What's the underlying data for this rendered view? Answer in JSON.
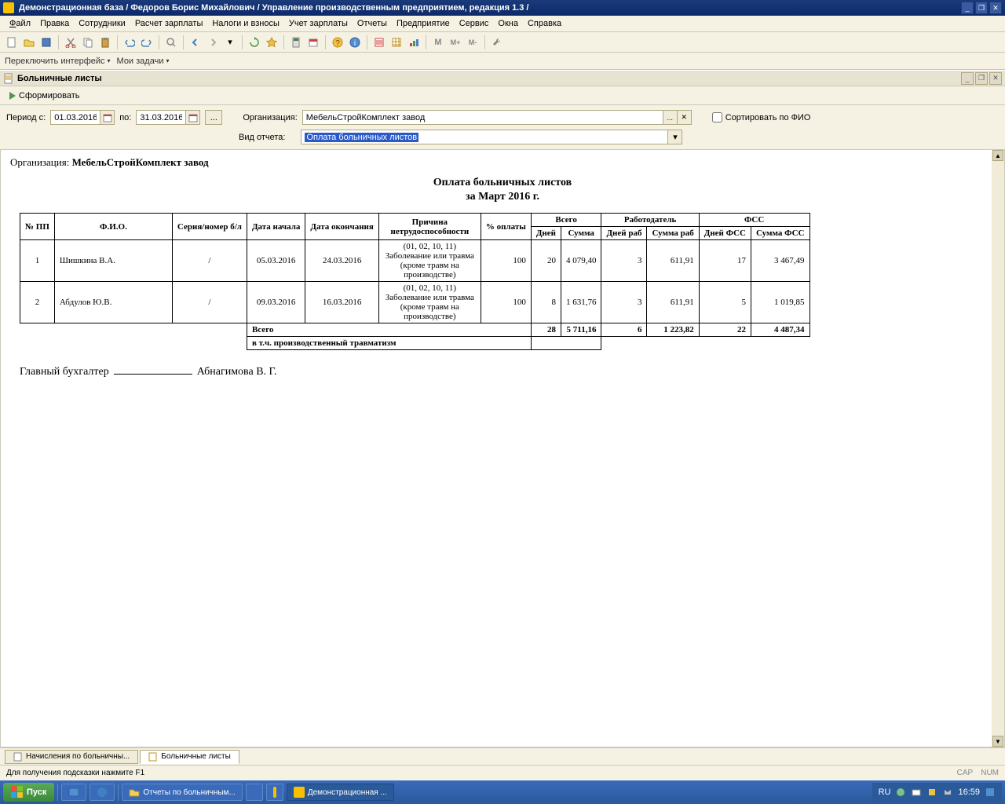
{
  "titlebar": {
    "text": "Демонстрационная база / Федоров Борис Михайлович / Управление производственным предприятием, редакция 1.3 /"
  },
  "menu": {
    "file": "Файл",
    "edit": "Правка",
    "employees": "Сотрудники",
    "payroll": "Расчет зарплаты",
    "taxes": "Налоги и взносы",
    "accounting": "Учет зарплаты",
    "reports": "Отчеты",
    "enterprise": "Предприятие",
    "service": "Сервис",
    "windows": "Окна",
    "help": "Справка"
  },
  "toolbar2": {
    "switch": "Переключить интерфейс",
    "tasks": "Мои задачи"
  },
  "doc": {
    "title": "Больничные листы",
    "action": "Сформировать",
    "period_label_from": "Период с:",
    "period_from": "01.03.2016",
    "period_label_to": "по:",
    "period_to": "31.03.2016",
    "org_label": "Организация:",
    "org_value": "МебельСтройКомплект завод",
    "type_label": "Вид отчета:",
    "type_value": "Оплата больничных листов",
    "sort_label": "Сортировать по ФИО"
  },
  "report": {
    "org_label": "Организация:",
    "org_name": "МебельСтройКомплект завод",
    "title": "Оплата больничных листов",
    "subtitle": "за Март 2016 г.",
    "headers": {
      "npp": "№ ПП",
      "fio": "Ф.И.О.",
      "serial": "Серия/номер б/л",
      "date_start": "Дата начала",
      "date_end": "Дата окончания",
      "reason": "Причина нетрудоспособности",
      "percent": "% оплаты",
      "total": "Всего",
      "employer": "Работодатель",
      "fss": "ФСС",
      "days": "Дней",
      "sum": "Сумма",
      "days_emp": "Дней раб",
      "sum_emp": "Сумма раб",
      "days_fss": "Дней ФСС",
      "sum_fss": "Сумма ФСС",
      "total_label": "Всего",
      "trauma_label": "в т.ч. производственный травматизм"
    },
    "rows": [
      {
        "n": "1",
        "fio": "Шишкина В.А.",
        "serial": "/",
        "start": "05.03.2016",
        "end": "24.03.2016",
        "reason": "(01, 02, 10, 11) Заболевание или травма (кроме травм на производстве)",
        "pct": "100",
        "days": "20",
        "sum": "4 079,40",
        "days_e": "3",
        "sum_e": "611,91",
        "days_f": "17",
        "sum_f": "3 467,49"
      },
      {
        "n": "2",
        "fio": "Абдулов Ю.В.",
        "serial": "/",
        "start": "09.03.2016",
        "end": "16.03.2016",
        "reason": "(01, 02, 10, 11) Заболевание или травма (кроме травм на производстве)",
        "pct": "100",
        "days": "8",
        "sum": "1 631,76",
        "days_e": "3",
        "sum_e": "611,91",
        "days_f": "5",
        "sum_f": "1 019,85"
      }
    ],
    "totals": {
      "days": "28",
      "sum": "5 711,16",
      "days_e": "6",
      "sum_e": "1 223,82",
      "days_f": "22",
      "sum_f": "4 487,34"
    },
    "signature_title": "Главный бухгалтер",
    "signature_name": "Абнагимова В. Г."
  },
  "tabs": {
    "tab1": "Начисления по больничны...",
    "tab2": "Больничные листы"
  },
  "statusbar": {
    "hint": "Для получения подсказки нажмите F1",
    "cap": "CAP",
    "num": "NUM"
  },
  "taskbar": {
    "start": "Пуск",
    "item1": "Отчеты по больничным...",
    "item2": "Демонстрационная ...",
    "lang": "RU",
    "time": "16:59"
  }
}
